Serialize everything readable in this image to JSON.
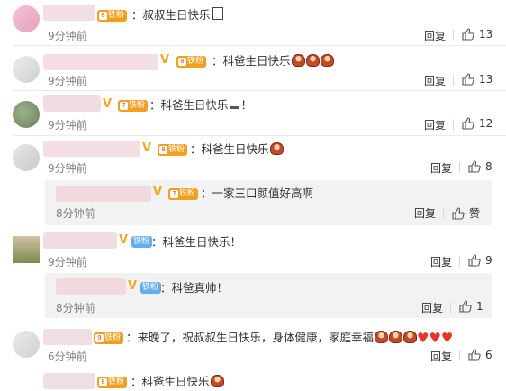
{
  "common": {
    "reply_label": "回复",
    "time_label": "9分钟前",
    "praise_label": "赞"
  },
  "comments": [
    {
      "text": "：叔叔生日快乐",
      "time": "9分钟前",
      "likes": "13",
      "badge": "铁粉"
    },
    {
      "text": "：科爸生日快乐",
      "time": "9分钟前",
      "likes": "13",
      "badge": "铁粉"
    },
    {
      "text": "：科爸生日快乐",
      "suffix": "！",
      "time": "9分钟前",
      "likes": "12",
      "badge": "铁粉"
    },
    {
      "text": "：科爸生日快乐",
      "time": "9分钟前",
      "likes": "8",
      "badge": "铁粉"
    },
    {
      "text": "：一家三口颜值好高啊",
      "time": "8分钟前",
      "badge": "铁粉"
    },
    {
      "text": "：科爸生日快乐！",
      "time": "9分钟前",
      "likes": "9",
      "badge": "铁粉"
    },
    {
      "text": "：科爸真帅！",
      "time": "8分钟前",
      "likes": "1",
      "badge": "铁粉"
    },
    {
      "text": "：来晚了，祝叔叔生日快乐，身体健康，家庭幸福",
      "time": "6分钟前",
      "likes": "6",
      "badge": "铁粉"
    },
    {
      "text": "：科爸生日快乐",
      "badge": "铁粉"
    }
  ],
  "colors": {
    "fan_gold": "#f0a01e",
    "fan_blue": "#63aef0",
    "vip": "#f5a623",
    "time": "#808080"
  },
  "icons": [
    "thumbs-up-icon",
    "cake-emoji",
    "heart-emoji",
    "gift-emoji",
    "v-badge-icon"
  ]
}
